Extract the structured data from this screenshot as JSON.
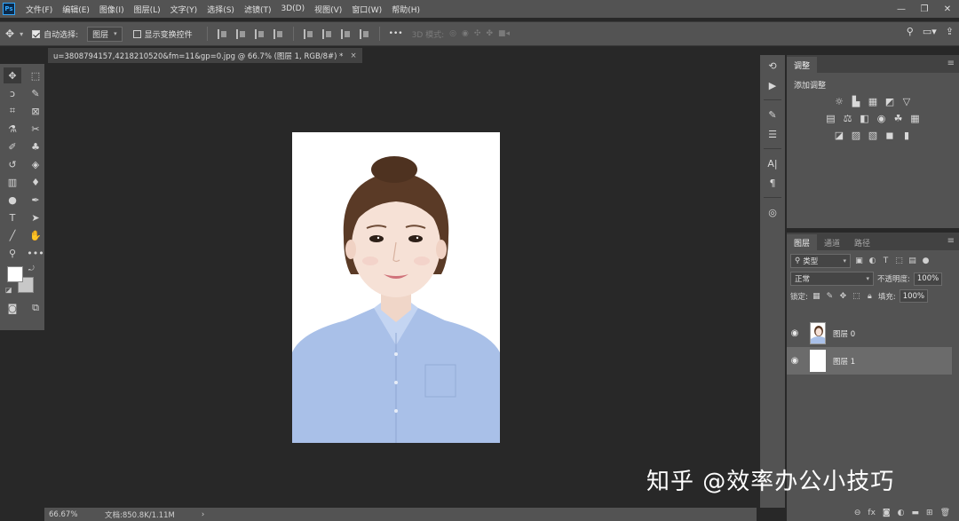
{
  "app": {
    "logo": "Ps"
  },
  "menu": [
    "文件(F)",
    "编辑(E)",
    "图像(I)",
    "图层(L)",
    "文字(Y)",
    "选择(S)",
    "滤镜(T)",
    "3D(D)",
    "视图(V)",
    "窗口(W)",
    "帮助(H)"
  ],
  "window_controls": {
    "minimize": "—",
    "restore": "❐",
    "close": "✕"
  },
  "options": {
    "auto_select_label": "自动选择:",
    "auto_select_checked": true,
    "auto_select_target": "图层",
    "show_transform_label": "显示变换控件",
    "show_transform_checked": false,
    "more": "•••",
    "mode_3d_label": "3D 模式:"
  },
  "document": {
    "tab_title": "u=3808794157,4218210520&fm=11&gp=0.jpg @ 66.7% (图层 1, RGB/8#) *",
    "close": "×"
  },
  "status": {
    "zoom": "66.67%",
    "doc_info": "文档:850.8K/1.11M",
    "arrow": "›"
  },
  "adjustments": {
    "tab": "调整",
    "title": "添加调整"
  },
  "layers": {
    "tabs": [
      "图层",
      "通道",
      "路径"
    ],
    "filter_kind": "类型",
    "blend_mode": "正常",
    "opacity_label": "不透明度:",
    "opacity_value": "100%",
    "lock_label": "锁定:",
    "fill_label": "填充:",
    "fill_value": "100%",
    "items": [
      {
        "name": "图层 0",
        "selected": false
      },
      {
        "name": "图层 1",
        "selected": true
      }
    ]
  },
  "watermark": "知乎 @效率办公小技巧",
  "colors": {
    "ui_panel": "#535353",
    "ui_dark": "#282828",
    "shirt": "#a9c0e8",
    "hair": "#5a3a26",
    "accent": "#31a8ff"
  }
}
